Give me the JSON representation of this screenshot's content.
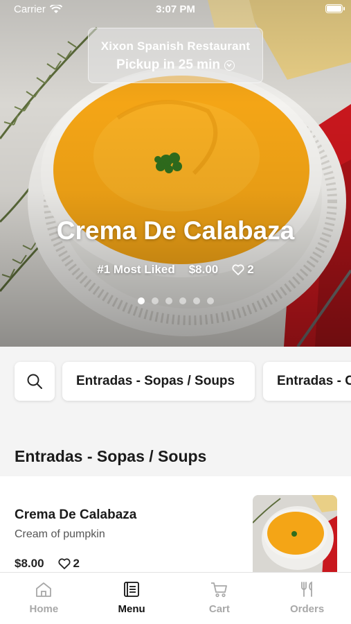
{
  "status_bar": {
    "carrier": "Carrier",
    "time": "3:07 PM"
  },
  "pickup": {
    "restaurant": "Xixon Spanish Restaurant",
    "eta": "Pickup in 25 min"
  },
  "hero": {
    "title": "Crema De Calabaza",
    "rank": "#1 Most Liked",
    "price": "$8.00",
    "likes": "2",
    "slide_count": 6,
    "active_slide": 1
  },
  "categories": {
    "chips": [
      "Entradas - Sopas / Soups",
      "Entradas - Chips"
    ]
  },
  "section": {
    "title": "Entradas - Sopas / Soups"
  },
  "menu_item": {
    "name": "Crema De Calabaza",
    "description": "Cream of pumpkin",
    "price": "$8.00",
    "likes": "2"
  },
  "tabs": [
    {
      "label": "Home",
      "icon": "home-icon",
      "active": false
    },
    {
      "label": "Menu",
      "icon": "menu-book-icon",
      "active": true
    },
    {
      "label": "Cart",
      "icon": "cart-icon",
      "active": false
    },
    {
      "label": "Orders",
      "icon": "fork-knife-icon",
      "active": false
    }
  ],
  "colors": {
    "soup": "#f4a516",
    "napkin": "#c8171d",
    "background": "#f4f4f4",
    "active_tab": "#111111",
    "inactive_tab": "#a8a8a8"
  }
}
